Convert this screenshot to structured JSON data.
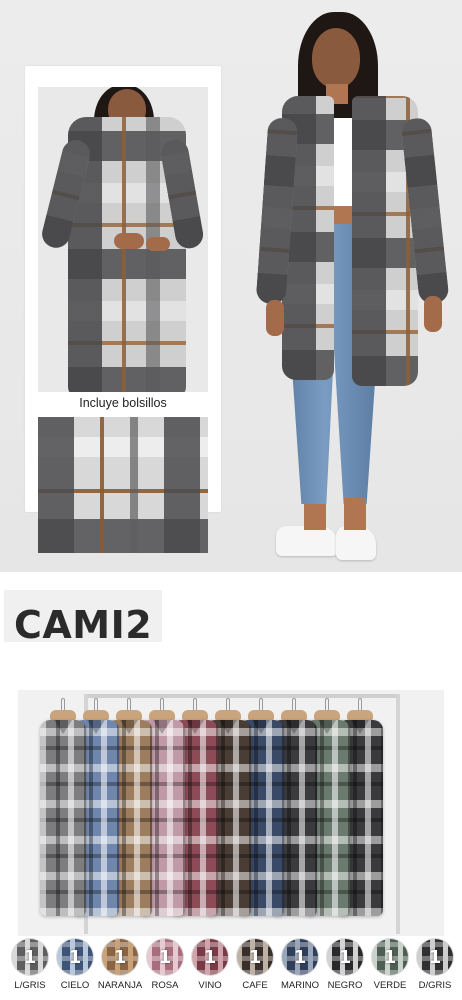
{
  "inset": {
    "caption": "Incluye bolsillos"
  },
  "product": {
    "code": "CAMI2"
  },
  "colors": {
    "items": [
      {
        "qty": "1",
        "name": "L/GRIS",
        "base": "#5f5f61",
        "stripe": "#d9d9d9"
      },
      {
        "qty": "1",
        "name": "CIELO",
        "base": "#3e5577",
        "stripe": "#b9c9dc"
      },
      {
        "qty": "1",
        "name": "NARANJA",
        "base": "#8a6443",
        "stripe": "#c9a27a"
      },
      {
        "qty": "1",
        "name": "ROSA",
        "base": "#a86e7e",
        "stripe": "#e7c9d2"
      },
      {
        "qty": "1",
        "name": "VINO",
        "base": "#7a3a45",
        "stripe": "#cfa5ab"
      },
      {
        "qty": "1",
        "name": "CAFE",
        "base": "#3b2f2b",
        "stripe": "#bfb3a8"
      },
      {
        "qty": "1",
        "name": "MARINO",
        "base": "#2f3f5a",
        "stripe": "#9aa6ba"
      },
      {
        "qty": "1",
        "name": "NEGRO",
        "base": "#2a2a2c",
        "stripe": "#d3d3d3"
      },
      {
        "qty": "1",
        "name": "VERDE",
        "base": "#4e5f55",
        "stripe": "#c9d3cb"
      },
      {
        "qty": "1",
        "name": "D/GRIS",
        "base": "#303033",
        "stripe": "#cfcfcf"
      }
    ]
  },
  "rack": {
    "shirts": [
      "#7d7d80",
      "#6f86ad",
      "#9c7d5e",
      "#c19aa8",
      "#8c4b56",
      "#4a3d36",
      "#3a4a66",
      "#3b3b3e",
      "#6a7a6f",
      "#3a3a3d"
    ]
  }
}
